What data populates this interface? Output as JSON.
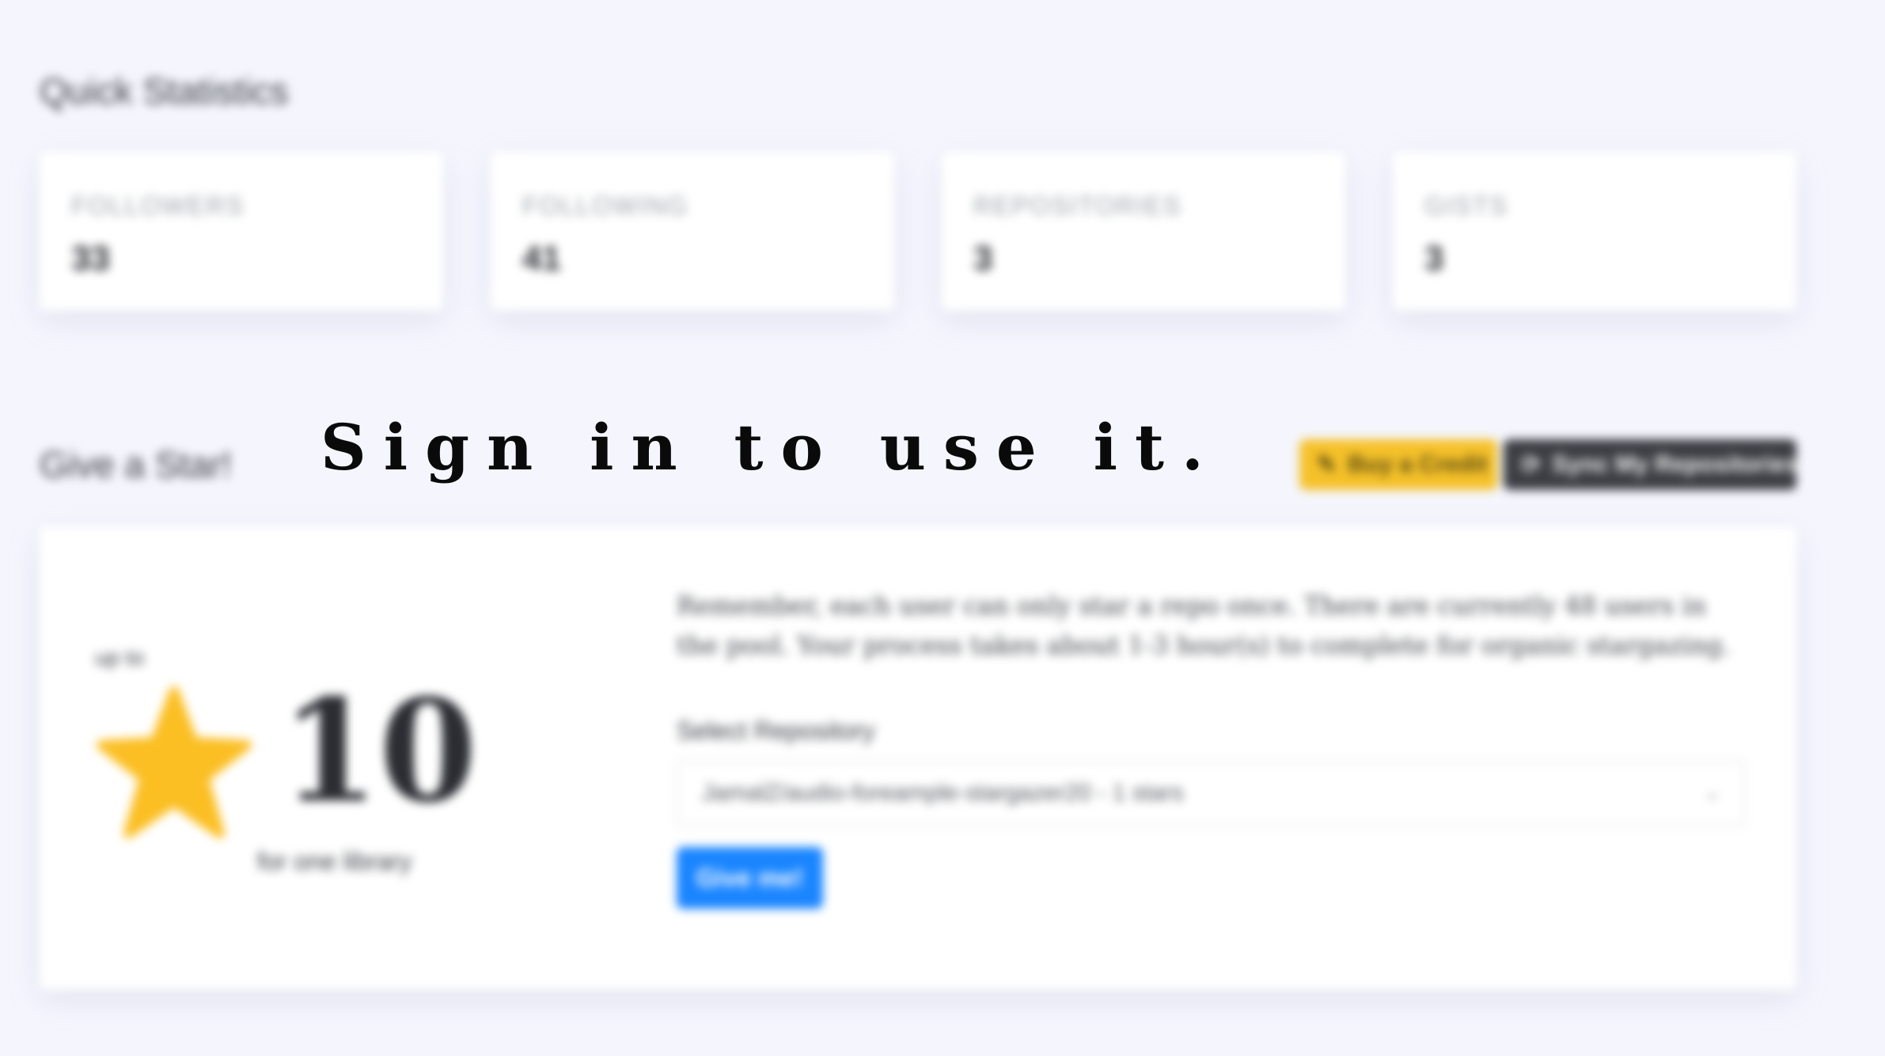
{
  "quick_stats": {
    "title": "Quick Statistics",
    "cards": [
      {
        "label": "FOLLOWERS",
        "value": "33"
      },
      {
        "label": "FOLLOWING",
        "value": "41"
      },
      {
        "label": "REPOSITORIES",
        "value": "3"
      },
      {
        "label": "GISTS",
        "value": "3"
      }
    ]
  },
  "give_star": {
    "title": "Give a Star!",
    "buy_credit_label": "Buy a Credit",
    "sync_repos_label": "Sync My Repositories",
    "up_to": "up to",
    "count": "10",
    "per_library": "for one library",
    "info": "Remember, each user can only star a repo once. There are currently 48 users in the pool. Your process takes about 1-3 hour(s) to complete for organic stargazing.",
    "select_label": "Select Repository",
    "selected_repo": "JamalZ/audio-foreample-stargazer20 - 1 stars",
    "button_label": "Give me!"
  },
  "overlay": {
    "text": "Sign in to use it."
  },
  "colors": {
    "background": "#f5f6fd",
    "star": "#fbbf24",
    "buy_credit": "#f5c12a",
    "sync_repos": "#3c3e44",
    "primary_button": "#1a85ff"
  },
  "icons": {
    "buy_credit": "pencil-icon",
    "sync_repos": "sync-icon",
    "star": "star-icon",
    "select": "chevron-down-icon"
  }
}
